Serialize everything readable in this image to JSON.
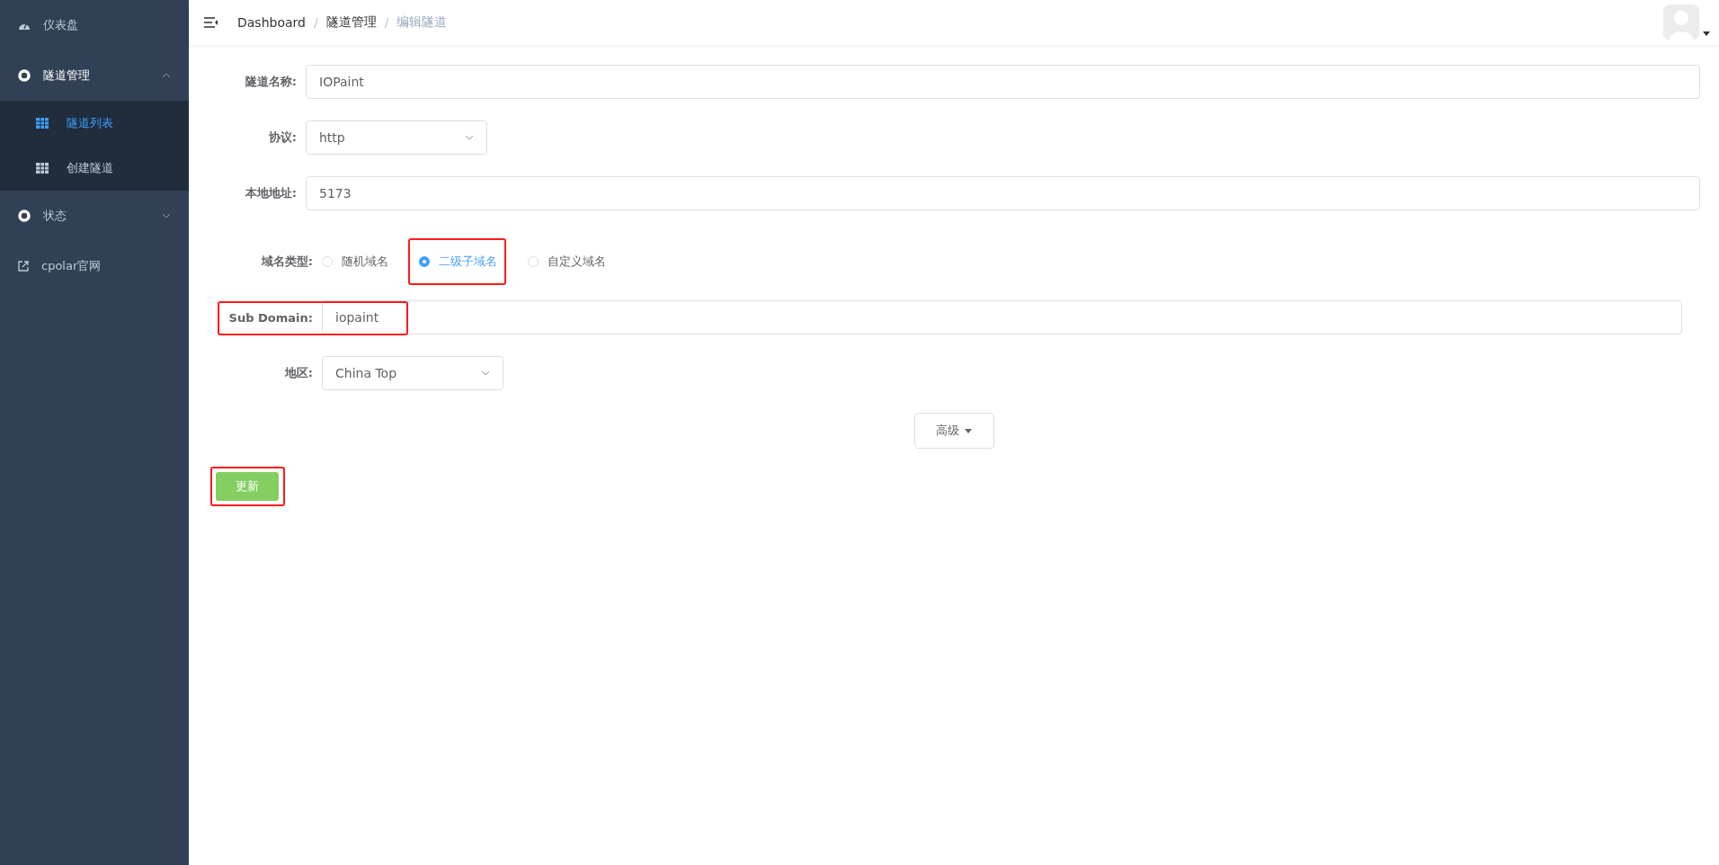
{
  "sidebar": {
    "items": [
      {
        "kind": "link",
        "label": "仪表盘"
      },
      {
        "kind": "group",
        "label": "隧道管理",
        "expanded": true,
        "children": [
          {
            "label": "隧道列表",
            "selected": true
          },
          {
            "label": "创建隧道",
            "selected": false
          }
        ]
      },
      {
        "kind": "group",
        "label": "状态",
        "expanded": false
      },
      {
        "kind": "external",
        "label": "cpolar官网"
      }
    ]
  },
  "breadcrumb": [
    {
      "label": "Dashboard",
      "current": false
    },
    {
      "separator": "/",
      "label": "隧道管理",
      "current": false
    },
    {
      "separator": "/",
      "label": "编辑隧道",
      "current": true
    }
  ],
  "form": {
    "tunnel_fields": [
      {
        "kind": "text",
        "label": "隧道名称:",
        "value": "IOPaint"
      },
      {
        "kind": "select",
        "label": "协议:",
        "value": "http"
      },
      {
        "kind": "text",
        "label": "本地地址:",
        "value": "5173"
      }
    ],
    "domain_fields": [
      {
        "kind": "radio",
        "label": "域名类型:",
        "options": [
          {
            "label": "随机域名",
            "selected": false,
            "highlighted": false
          },
          {
            "label": "二级子域名",
            "selected": true,
            "highlighted": true
          },
          {
            "label": "自定义域名",
            "selected": false,
            "highlighted": false
          }
        ]
      },
      {
        "kind": "text",
        "label": "Sub Domain:",
        "value": "iopaint",
        "highlighted": true
      },
      {
        "kind": "select",
        "label": "地区:",
        "value": "China Top"
      }
    ],
    "advanced_button": "高级",
    "submit": {
      "label": "更新",
      "highlighted": true
    }
  }
}
